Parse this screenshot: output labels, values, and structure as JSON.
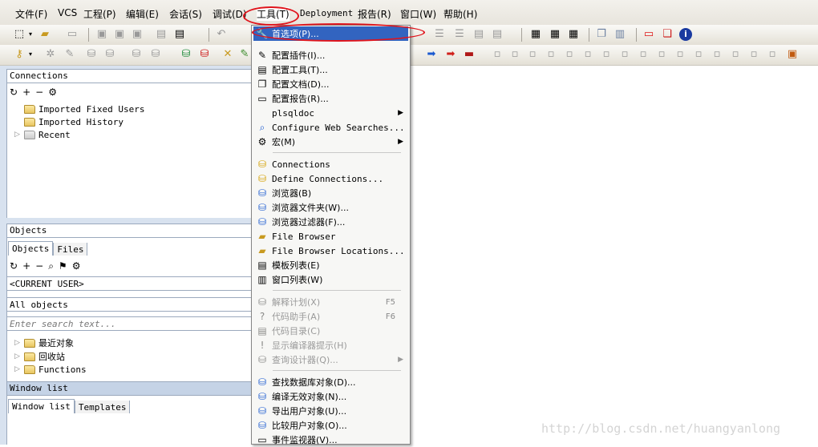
{
  "menubar": {
    "items": [
      "文件(F)",
      "VCS",
      "工程(P)",
      "编辑(E)",
      "会话(S)",
      "调试(D)",
      "工具(T)",
      "Deployment",
      "报告(R)",
      "窗口(W)",
      "帮助(H)"
    ]
  },
  "tools_menu": {
    "items": [
      {
        "label": "首选项(P)...",
        "icon": "wrench-icon"
      },
      {
        "label": "配置插件(I)...",
        "icon": "plugin-icon"
      },
      {
        "label": "配置工具(T)...",
        "icon": "tools-icon"
      },
      {
        "label": "配置文档(D)...",
        "icon": "documents-icon"
      },
      {
        "label": "配置报告(R)...",
        "icon": "report-icon"
      },
      {
        "label": "plsqldoc",
        "submenu": true
      },
      {
        "label": "Configure Web Searches...",
        "icon": "web-search-icon"
      },
      {
        "label": "宏(M)",
        "icon": "macro-icon",
        "submenu": true
      },
      {
        "label": "Connections",
        "icon": "database-icon"
      },
      {
        "label": "Define Connections...",
        "icon": "define-connections-icon"
      },
      {
        "label": "浏览器(B)",
        "icon": "browser-icon"
      },
      {
        "label": "浏览器文件夹(W)...",
        "icon": "browser-folders-icon"
      },
      {
        "label": "浏览器过滤器(F)...",
        "icon": "browser-filters-icon"
      },
      {
        "label": "File Browser",
        "icon": "file-browser-icon"
      },
      {
        "label": "File Browser Locations...",
        "icon": "file-browser-locations-icon"
      },
      {
        "label": "模板列表(E)",
        "icon": "template-list-icon"
      },
      {
        "label": "窗口列表(W)",
        "icon": "window-list-icon"
      },
      {
        "label": "解释计划(X)",
        "shortcut": "F5",
        "disabled": true,
        "icon": "explain-plan-icon"
      },
      {
        "label": "代码助手(A)",
        "shortcut": "F6",
        "disabled": true,
        "icon": "code-assistant-icon"
      },
      {
        "label": "代码目录(C)",
        "disabled": true,
        "icon": "code-contents-icon"
      },
      {
        "label": "显示编译器提示(H)",
        "disabled": true,
        "icon": "compiler-hints-icon"
      },
      {
        "label": "查询设计器(Q)...",
        "disabled": true,
        "icon": "query-builder-icon",
        "submenu": true
      },
      {
        "label": "查找数据库对象(D)...",
        "icon": "find-objects-icon"
      },
      {
        "label": "编译无效对象(N)...",
        "icon": "compile-invalid-icon"
      },
      {
        "label": "导出用户对象(U)...",
        "icon": "export-user-objects-icon"
      },
      {
        "label": "比较用户对象(O)...",
        "icon": "compare-user-objects-icon"
      },
      {
        "label": "事件监视器(V)...",
        "icon": "event-monitor-icon"
      }
    ]
  },
  "connections_panel": {
    "title": "Connections",
    "items": [
      "Imported Fixed Users",
      "Imported History",
      "Recent"
    ]
  },
  "objects_panel": {
    "title": "Objects",
    "tabs": [
      "Objects",
      "Files"
    ],
    "user_select": "<CURRENT USER>",
    "filter_select": "All objects",
    "search_placeholder": "Enter search text...",
    "items": [
      "最近对象",
      "回收站",
      "Functions"
    ]
  },
  "window_list_panel": {
    "title": "Window list",
    "tabs": [
      "Window list",
      "Templates"
    ]
  },
  "watermark": "http://blog.csdn.net/huangyanlong",
  "colors": {
    "highlight": "#3264c0",
    "annotation": "#e0141c",
    "panel_background": "#d8e2ef"
  }
}
